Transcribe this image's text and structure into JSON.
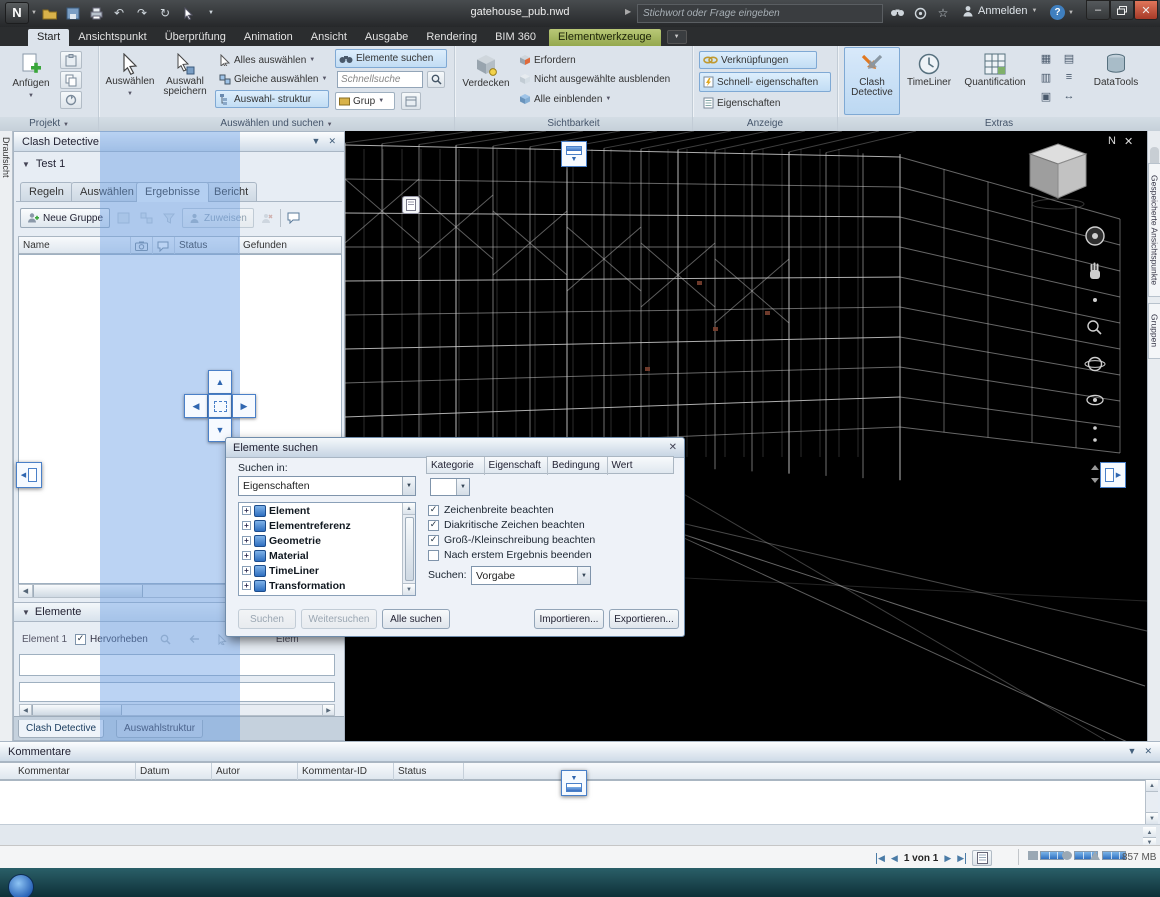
{
  "colors": {
    "accent": "#3a7bbf",
    "ribbon_highlight": "#cde2f6",
    "contextual_tab_green": "#94a84e",
    "dock_overlay": "rgba(104,158,228,0.45)",
    "viewport_bg": "#000000"
  },
  "titlebar": {
    "document_title": "gatehouse_pub.nwd",
    "search_placeholder": "Stichwort oder Frage eingeben",
    "signin_label": "Anmelden"
  },
  "ribbon": {
    "tabs": [
      {
        "label": "Start"
      },
      {
        "label": "Ansichtspunkt"
      },
      {
        "label": "Überprüfung"
      },
      {
        "label": "Animation"
      },
      {
        "label": "Ansicht"
      },
      {
        "label": "Ausgabe"
      },
      {
        "label": "Rendering"
      },
      {
        "label": "BIM 360"
      },
      {
        "label": "Elementwerkzeuge"
      }
    ],
    "groups": {
      "projekt": {
        "label": "Projekt",
        "append": "Anfügen"
      },
      "auswaehlen": {
        "label": "Auswählen und suchen",
        "select": "Auswählen",
        "save_selection": "Auswahl speichern",
        "select_all": "Alles auswählen",
        "select_same": "Gleiche auswählen",
        "selection_tree": "Auswahl- struktur",
        "find_items": "Elemente suchen",
        "quick_find_placeholder": "Schnellsuche",
        "group_button": "Grup"
      },
      "sichtbarkeit": {
        "label": "Sichtbarkeit",
        "hide": "Verdecken",
        "require": "Erfordern",
        "hide_unselected": "Nicht ausgewählte ausblenden",
        "unhide_all": "Alle einblenden"
      },
      "anzeige": {
        "label": "Anzeige",
        "links": "Verknüpfungen",
        "quick_properties": "Schnell- eigenschaften",
        "properties": "Eigenschaften"
      },
      "extras": {
        "label": "Extras",
        "clash_detective": "Clash Detective",
        "timeliner": "TimeLiner",
        "quantification": "Quantification",
        "datatools": "DataTools"
      }
    }
  },
  "clash_panel": {
    "title": "Clash Detective",
    "test_name": "Test 1",
    "tabs": [
      "Regeln",
      "Auswählen",
      "Ergebnisse",
      "Bericht"
    ],
    "active_tab": "Ergebnisse",
    "new_group": "Neue Gruppe",
    "assign": "Zuweisen",
    "columns": {
      "name": "Name",
      "status": "Status",
      "found": "Gefunden"
    },
    "items_section": "Elemente",
    "element1_label": "Element 1",
    "highlight_label": "Hervorheben",
    "element2_partial": "Elem",
    "bottom_tabs": [
      "Clash Detective",
      "Auswahlstruktur"
    ]
  },
  "find_dialog": {
    "title": "Elemente suchen",
    "search_in_label": "Suchen in:",
    "search_in_value": "Eigenschaften",
    "tree": [
      "Element",
      "Elementreferenz",
      "Geometrie",
      "Material",
      "TimeLiner",
      "Transformation"
    ],
    "columns": [
      "Kategorie",
      "Eigenschaft",
      "Bedingung",
      "Wert"
    ],
    "checkboxes": [
      {
        "label": "Zeichenbreite beachten",
        "checked": true
      },
      {
        "label": "Diakritische Zeichen beachten",
        "checked": true
      },
      {
        "label": "Groß-/Kleinschreibung beachten",
        "checked": true
      },
      {
        "label": "Nach erstem Ergebnis beenden",
        "checked": false
      }
    ],
    "search_mode_label": "Suchen:",
    "search_mode_value": "Vorgabe",
    "buttons": {
      "find": "Suchen",
      "find_next": "Weitersuchen",
      "find_all": "Alle suchen",
      "import": "Importieren...",
      "export": "Exportieren..."
    }
  },
  "comments_panel": {
    "title": "Kommentare",
    "columns": [
      "Kommentar",
      "Datum",
      "Autor",
      "Kommentar-ID",
      "Status"
    ]
  },
  "side_tabs": {
    "left": "Draufsicht",
    "right": [
      "Gespeicherte Ansichtspunkte",
      "Gruppen"
    ]
  },
  "viewport": {
    "badge": "N"
  },
  "statusbar": {
    "page_indicator": "1 von 1",
    "memory": "857 MB"
  }
}
